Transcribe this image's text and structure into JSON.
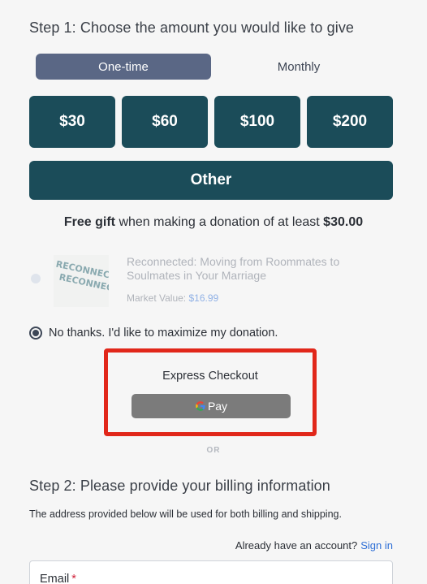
{
  "step1": {
    "title": "Step 1: Choose the amount you would like to give"
  },
  "frequency": {
    "options": [
      "One-time",
      "Monthly"
    ],
    "selected": "One-time"
  },
  "amounts": [
    "$30",
    "$60",
    "$100",
    "$200"
  ],
  "other_label": "Other",
  "free_gift": {
    "bold": "Free gift",
    "text": " when making a donation of at least ",
    "amount": "$30.00"
  },
  "gift_item": {
    "title": "Reconnected: Moving from Roommates to Soulmates in Your Marriage",
    "market_value_label": "Market Value:",
    "market_value": "$16.99",
    "cover_line1": "RECONNECTED",
    "cover_line2": "RECONNECTED"
  },
  "no_thanks_label": "No thanks. I'd like to maximize my donation.",
  "express_checkout": {
    "title": "Express Checkout",
    "gpay_label": "Pay",
    "highlight_color": "#e1271a"
  },
  "or_label": "OR",
  "step2": {
    "title": "Step 2: Please provide your billing information",
    "note": "The address provided below will be used for both billing and shipping.",
    "account_prompt": "Already have an account?",
    "sign_in_label": "Sign in",
    "email_label": "Email",
    "required_marker": "*"
  },
  "colors": {
    "primary": "#1b4c59",
    "toggle_active": "#5a6785",
    "link": "#2e6fd6"
  }
}
